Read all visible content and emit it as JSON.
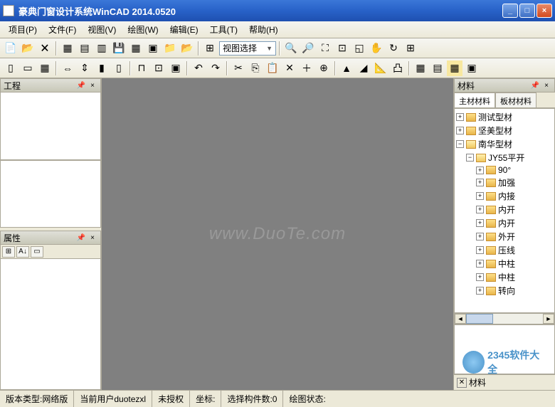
{
  "window": {
    "title": "豪典门窗设计系统WinCAD 2014.0520"
  },
  "menu": {
    "project": "项目(P)",
    "file": "文件(F)",
    "view": "视图(V)",
    "draw": "绘图(W)",
    "edit": "编辑(E)",
    "tools": "工具(T)",
    "help": "帮助(H)"
  },
  "toolbar1": {
    "view_select_label": "视图选择"
  },
  "panels": {
    "project": {
      "title": "工程"
    },
    "property": {
      "title": "属性"
    },
    "material": {
      "title": "材料"
    },
    "material_tabs": {
      "main": "主材材料",
      "board": "板材材料"
    },
    "material_bottom_tab": "材料"
  },
  "tree": {
    "n1": "测试型材",
    "n2": "坚美型材",
    "n3": "南华型材",
    "n3_1": "JY55平开",
    "n3_1_1": "90°",
    "n3_1_2": "加强",
    "n3_1_3": "内接",
    "n3_1_4": "内开",
    "n3_1_5": "内开",
    "n3_1_6": "外开",
    "n3_1_7": "压线",
    "n3_1_8": "中柱",
    "n3_1_9": "中柱",
    "n3_1_10": "转向"
  },
  "watermark": "www.DuoTe.com",
  "status": {
    "version_type_label": "版本类型:",
    "version_type_value": "网络版",
    "current_user_label": "当前用户",
    "current_user_value": "duotezxl",
    "auth": "未授权",
    "coord_label": "坐标:",
    "select_count_label": "选择构件数:",
    "select_count_value": "0",
    "draw_state_label": "绘图状态:"
  },
  "badge": "2345软件大全"
}
